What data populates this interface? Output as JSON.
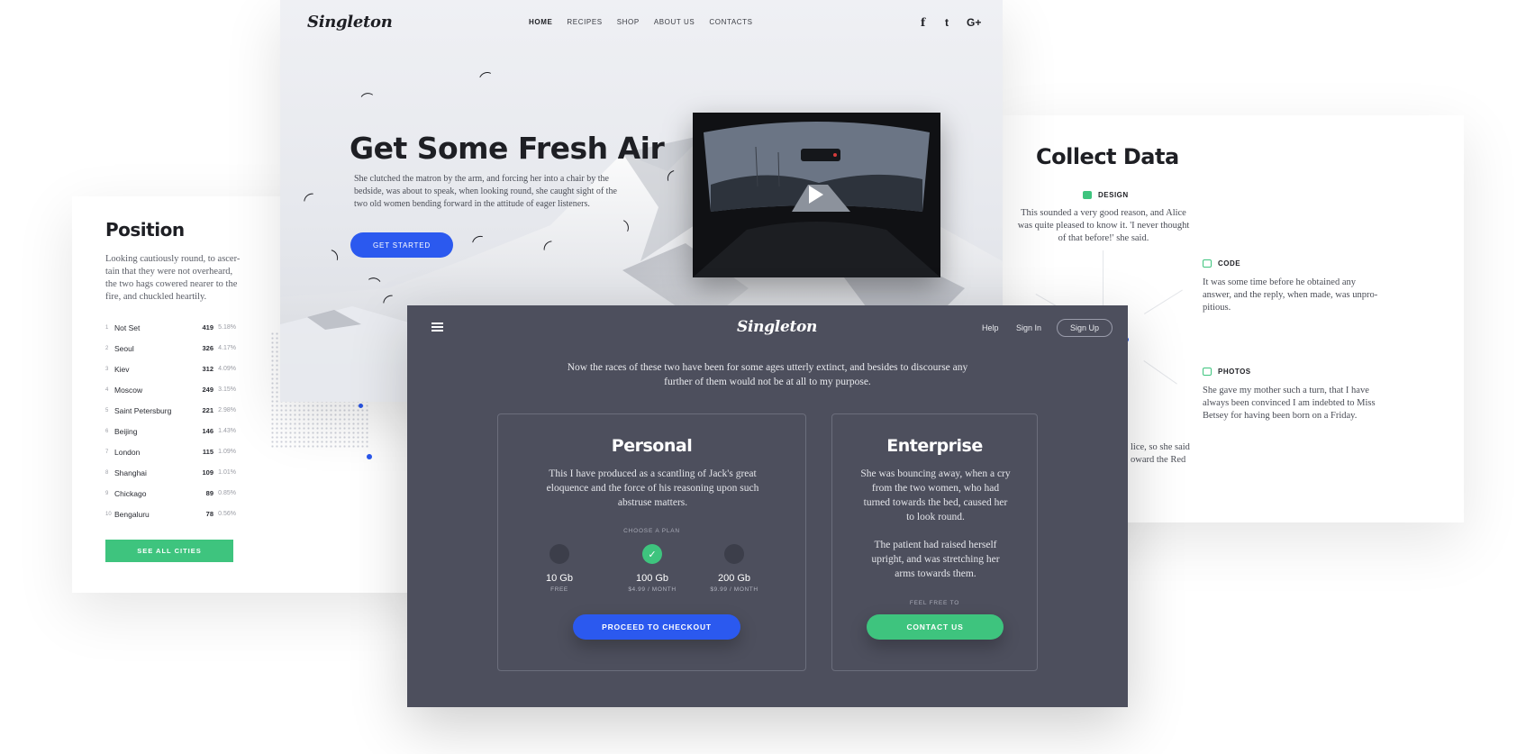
{
  "position_card": {
    "title": "Position",
    "description": "Looking cautiously round, to ascer-tain that they were not overheard, the two hags cowered nearer to the fire, and chuckled heartily.",
    "cities": [
      {
        "rank": "1",
        "name": "Not Set",
        "count": "419",
        "percent": "5.18%"
      },
      {
        "rank": "2",
        "name": "Seoul",
        "count": "326",
        "percent": "4.17%"
      },
      {
        "rank": "3",
        "name": "Kiev",
        "count": "312",
        "percent": "4.09%"
      },
      {
        "rank": "4",
        "name": "Moscow",
        "count": "249",
        "percent": "3.15%"
      },
      {
        "rank": "5",
        "name": "Saint Petersburg",
        "count": "221",
        "percent": "2.98%"
      },
      {
        "rank": "6",
        "name": "Beijing",
        "count": "146",
        "percent": "1.43%"
      },
      {
        "rank": "7",
        "name": "London",
        "count": "115",
        "percent": "1.09%"
      },
      {
        "rank": "8",
        "name": "Shanghai",
        "count": "109",
        "percent": "1.01%"
      },
      {
        "rank": "9",
        "name": "Chickago",
        "count": "89",
        "percent": "0.85%"
      },
      {
        "rank": "10",
        "name": "Bengaluru",
        "count": "78",
        "percent": "0.56%"
      }
    ],
    "button": "SEE ALL CITIES"
  },
  "collect_card": {
    "title": "Collect Data",
    "design_label": "DESIGN",
    "design_text": "This sounded a very good reason, and Alice was quite pleased to know it. 'I never thought of that before!' she said.",
    "code_label": "CODE",
    "code_text": "It was some time before he obtained any answer, and the reply, when made, was unpro-pitious.",
    "photos_label": "PHOTOS",
    "photos_text": "She gave my mother such a turn, that I have always been convinced I am indebted to Miss Betsey for having been born on a Friday.",
    "partial_text": "lice, so she said\noward the Red"
  },
  "hero": {
    "logo": "Singleton",
    "nav": [
      "HOME",
      "RECIPES",
      "SHOP",
      "ABOUT US",
      "CONTACTS"
    ],
    "social": {
      "facebook": "f",
      "twitter": "t",
      "google": "G+"
    },
    "title": "Get Some Fresh Air",
    "text": "She clutched the matron by the arm, and forcing her into a chair by the bedside, was about to speak, when looking round, she caught sight of the two old women bending forward in the attitude of eager listeners.",
    "button": "GET STARTED",
    "icons": {
      "play": "play-icon",
      "bird": "bird-icon"
    }
  },
  "pricing": {
    "logo": "Singleton",
    "help": "Help",
    "signin": "Sign In",
    "signup": "Sign Up",
    "lead": "Now the races of these two have been for some ages utterly extinct, and besides to discourse any further of them would not be at all to my purpose.",
    "personal": {
      "title": "Personal",
      "text": "This I have produced as a scantling of Jack's great eloquence and the force of his reasoning upon such abstruse matters.",
      "choose": "CHOOSE A PLAN",
      "options": [
        {
          "size": "10 Gb",
          "price": "FREE",
          "selected": false
        },
        {
          "size": "100 Gb",
          "price": "$4.99 / MONTH",
          "selected": true
        },
        {
          "size": "200 Gb",
          "price": "$9.99 / MONTH",
          "selected": false
        }
      ],
      "button": "PROCEED TO CHECKOUT"
    },
    "enterprise": {
      "title": "Enterprise",
      "text1": "She was bouncing away, when a cry from the two women, who had turned towards the bed, caused her to look round.",
      "text2": "The patient had raised herself upright, and was stretching her arms towards them.",
      "free": "FEEL FREE TO",
      "button": "CONTACT US"
    }
  },
  "colors": {
    "blue": "#2b59ef",
    "green": "#3ec47e",
    "slate": "#4d4f5d"
  }
}
